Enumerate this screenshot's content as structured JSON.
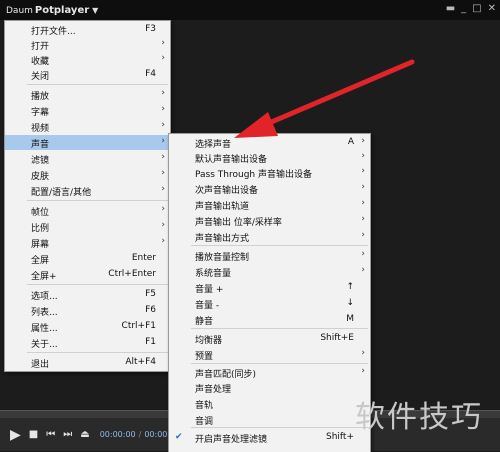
{
  "app": {
    "logo_prefix": "Daum",
    "logo_name": "Potplayer"
  },
  "controls": {
    "time_current": "00:00:00",
    "time_total": "00:00:00"
  },
  "menu_main": [
    {
      "label": "打开文件...",
      "shortcut": "F3"
    },
    {
      "label": "打开",
      "submenu": true
    },
    {
      "label": "收藏",
      "submenu": true
    },
    {
      "label": "关闭",
      "shortcut": "F4"
    },
    {
      "label": "播放",
      "submenu": true
    },
    {
      "label": "字幕",
      "submenu": true
    },
    {
      "label": "视频",
      "submenu": true
    },
    {
      "label": "声音",
      "submenu": true,
      "highlight": true
    },
    {
      "label": "滤镜",
      "submenu": true
    },
    {
      "label": "皮肤",
      "submenu": true
    },
    {
      "label": "配置/语言/其他",
      "submenu": true
    },
    {
      "label": "帧位",
      "submenu": true
    },
    {
      "label": "比例",
      "submenu": true
    },
    {
      "label": "屏幕",
      "submenu": true
    },
    {
      "label": "全屏",
      "shortcut": "Enter"
    },
    {
      "label": "全屏+",
      "shortcut": "Ctrl+Enter"
    },
    {
      "label": "选项...",
      "shortcut": "F5"
    },
    {
      "label": "列表...",
      "shortcut": "F6"
    },
    {
      "label": "属性...",
      "shortcut": "Ctrl+F1"
    },
    {
      "label": "关于...",
      "shortcut": "F1"
    },
    {
      "label": "退出",
      "shortcut": "Alt+F4"
    }
  ],
  "menu_sound": [
    {
      "label": "选择声音",
      "shortcut": "A",
      "submenu": true
    },
    {
      "label": "默认声音输出设备",
      "submenu": true
    },
    {
      "label": "Pass Through 声音输出设备",
      "submenu": true
    },
    {
      "label": "次声音输出设备",
      "submenu": true
    },
    {
      "label": "声音输出轨道",
      "submenu": true
    },
    {
      "label": "声音输出 位率/采样率",
      "submenu": true
    },
    {
      "label": "声音输出方式",
      "submenu": true
    },
    {
      "label": "播放音量控制",
      "submenu": true
    },
    {
      "label": "系统音量",
      "submenu": true
    },
    {
      "label": "音量 +",
      "shortcut": "↑"
    },
    {
      "label": "音量 -",
      "shortcut": "↓"
    },
    {
      "label": "静音",
      "shortcut": "M"
    },
    {
      "label": "均衡器",
      "shortcut": "Shift+E"
    },
    {
      "label": "预置",
      "submenu": true
    },
    {
      "label": "声音匹配(同步)",
      "submenu": true
    },
    {
      "label": "声音处理"
    },
    {
      "label": "音轨"
    },
    {
      "label": "音调"
    },
    {
      "label": "开启声音处理滤镜",
      "shortcut": "Shift+",
      "checked": true
    }
  ],
  "watermark": "软件技巧",
  "colors": {
    "highlight": "#a8c8ec",
    "arrow": "#e0242a",
    "menu_bg": "#f2f2f2"
  }
}
